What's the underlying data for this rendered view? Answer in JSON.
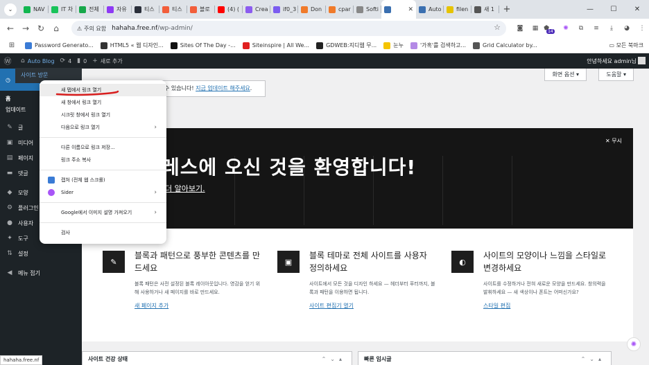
{
  "browser": {
    "tabs": [
      {
        "label": "NAV",
        "color": "#12b650"
      },
      {
        "label": "IT 차",
        "color": "#19c35a"
      },
      {
        "label": "전체",
        "color": "#17a84a"
      },
      {
        "label": "자유",
        "color": "#8e3af5"
      },
      {
        "label": "티스",
        "color": "#2a2f3a"
      },
      {
        "label": "티스",
        "color": "#f25e3a"
      },
      {
        "label": "블로",
        "color": "#f25e3a"
      },
      {
        "label": "(4) (",
        "color": "#ff0000"
      },
      {
        "label": "Crea",
        "color": "#8c5cf0"
      },
      {
        "label": "if0_3",
        "color": "#7b5cf0"
      },
      {
        "label": "Don",
        "color": "#f07a2a"
      },
      {
        "label": "cpar",
        "color": "#f07a2a"
      },
      {
        "label": "Softi",
        "color": "#888888"
      },
      {
        "label": "",
        "color": "#3a6fb0"
      },
      {
        "label": "Auto",
        "color": "#3a6fb0"
      },
      {
        "label": "filen",
        "color": "#e6c300"
      },
      {
        "label": "새 1",
        "color": "#555555"
      }
    ],
    "active_tab_close": "✕",
    "new_tab": "+",
    "window_controls": [
      "—",
      "☐",
      "✕"
    ],
    "security_label": "주의 요함",
    "url_host": "hahaha.free.nf",
    "url_path": "/wp-admin/",
    "ext_badge": "14"
  },
  "bookmarks": [
    {
      "label": "Password Generato...",
      "color": "#3a7bd5"
    },
    {
      "label": "HTML5 « 웹 디자인...",
      "color": "#333333"
    },
    {
      "label": "Sites Of The Day -...",
      "color": "#111111"
    },
    {
      "label": "Siteinspire | All We...",
      "color": "#e02020"
    },
    {
      "label": "GDWEB:지디웹 무...",
      "color": "#222222"
    },
    {
      "label": "눈누",
      "color": "#f5c400"
    },
    {
      "label": "'가혹'를 검색하고...",
      "color": "#b48ae6"
    },
    {
      "label": "Grid Calculator by...",
      "color": "#555555"
    }
  ],
  "bookmarks_all": "모든 북마크",
  "adminbar": {
    "site": "Auto Blog",
    "updates": "4",
    "comments": "0",
    "new": "새로 추가",
    "howdy": "안녕하세요 admin님"
  },
  "sidebar": {
    "visit_site": "사이트 방문",
    "dashboard": "",
    "sub": [
      "홈",
      "업데이트"
    ],
    "items": [
      {
        "icon": "✎",
        "label": "글"
      },
      {
        "icon": "▣",
        "label": "미디어"
      },
      {
        "icon": "▤",
        "label": "페이지"
      },
      {
        "icon": "▬",
        "label": "댓글"
      },
      {
        "icon": "◆",
        "label": "모양"
      },
      {
        "icon": "⚙",
        "label": "플러그인"
      },
      {
        "icon": "●",
        "label": "사용자"
      },
      {
        "icon": "✦",
        "label": "도구"
      },
      {
        "icon": "⇅",
        "label": "설정"
      },
      {
        "icon": "◀",
        "label": "메뉴 접기"
      }
    ]
  },
  "main": {
    "screen_options": "화면 옵션 ▾",
    "help": "도움말 ▾",
    "notice_text": "수 있습니다!",
    "notice_link": "지금 업데이트 해주세요",
    "notice_end": ".",
    "welcome_title": "레스에 오신 것을 환영합니다!",
    "welcome_learn": "더 알아보기.",
    "dismiss": "✕ 무시",
    "panels": [
      {
        "icon": "✎",
        "title": "블록과 패턴으로 풍부한 콘텐츠를 만드세요",
        "body": "블록 패턴은 사전 설정된 블록 레이아웃입니다. 영감을 얻기 위해 사용하거나 새 페이지를 바로 만드세요.",
        "link": "새 페이지 추가"
      },
      {
        "icon": "▣",
        "title": "블록 테마로 전체 사이트를 사용자 정의하세요",
        "body": "사이트에서 모든 것을 디자인 하세요 — 헤더부터 푸터까지, 블록과 패턴을 이용하면 됩니다.",
        "link": "사이트 편집기 열기"
      },
      {
        "icon": "◐",
        "title": "사이트의 모양이나 느낌을 스타일로 변경하세요",
        "body": "사이트를 수정하거나 전혀 새로운 모양을 만드세요. 창의력을 발휘하세요 — 새 색상이나 폰트는 어떠신가요?",
        "link": "스타일 편집"
      }
    ],
    "widget_health": "사이트 건강 상태",
    "widget_draft": "빠른 임시글",
    "widget_controls": "⌃⌄▴"
  },
  "statusbar": "hahaha.free.nf",
  "context_menu": {
    "items_1": [
      "새 탭에서 링크 열기",
      "새 창에서 링크 열기",
      "시크릿 창에서 링크 열기",
      "다음으로 링크 열기"
    ],
    "items_2": [
      "다른 이름으로 링크 저장...",
      "링크 주소 복사"
    ],
    "items_3": [
      "캡처 (전체 웹 스크롤)",
      "Sider"
    ],
    "items_4": [
      "Google에서 이미지 설명 가져오기"
    ],
    "items_5": [
      "검사"
    ]
  }
}
